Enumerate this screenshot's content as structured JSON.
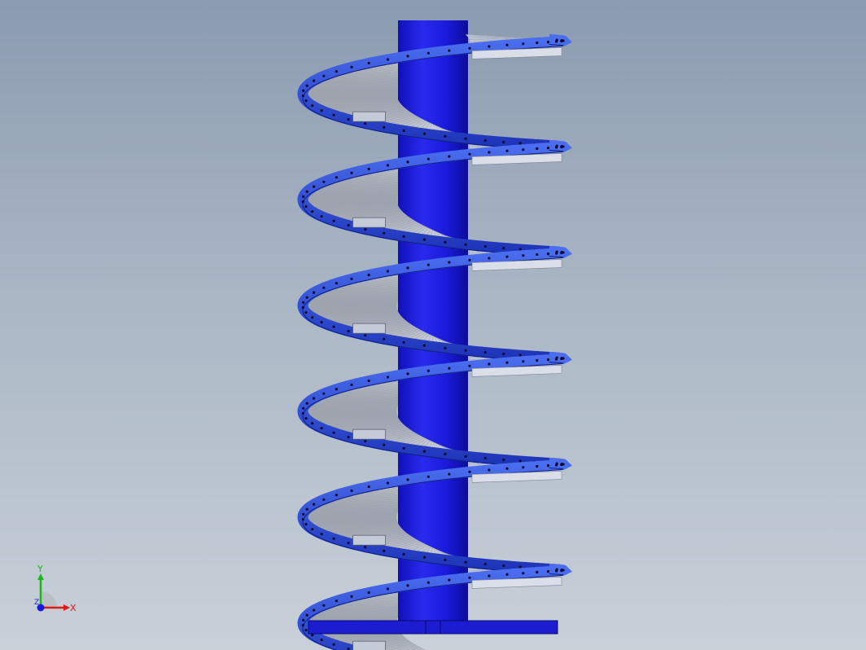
{
  "viewport": {
    "background_top": "#8b9bb0",
    "background_bottom": "#c9d0d8"
  },
  "model": {
    "description_icon": "spiral-conveyor-model",
    "column_color": "#1d1de0",
    "rail_color": "#2a48d8",
    "roller_color": "#e8ecf2",
    "turns": 6
  },
  "triad": {
    "x_label": "X",
    "y_label": "Y",
    "z_label": "Z",
    "x_color": "#e01818",
    "y_color": "#18b818",
    "z_color": "#1818e0"
  }
}
